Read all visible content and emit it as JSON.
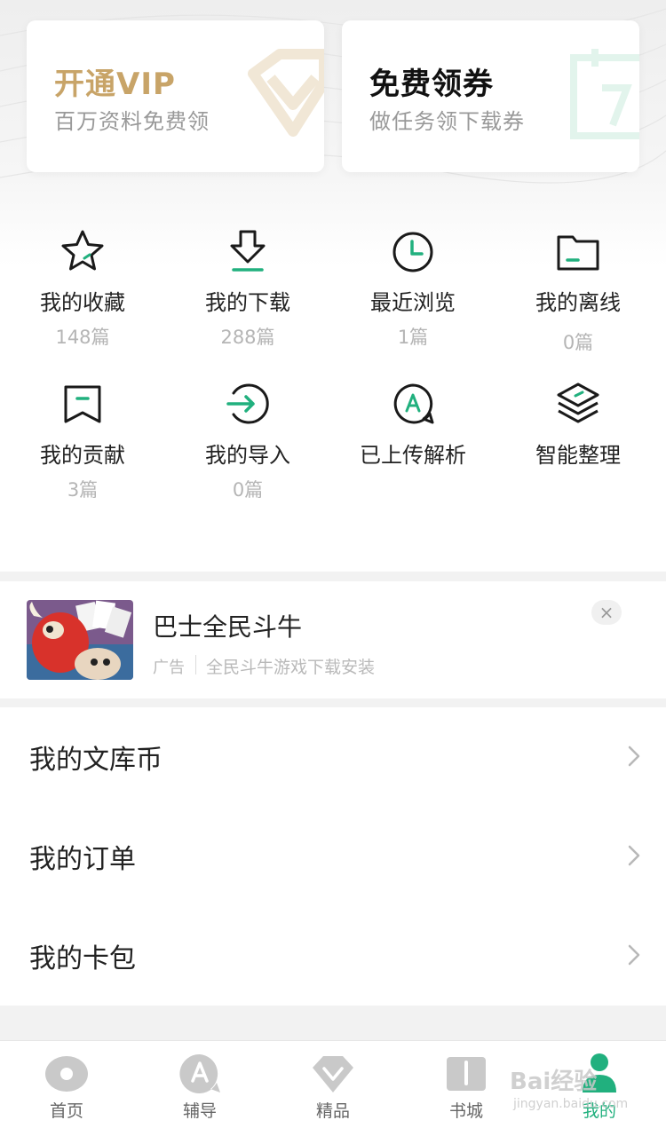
{
  "promos": {
    "vip": {
      "title": "开通VIP",
      "subtitle": "百万资料免费领",
      "icon": "diamond-icon"
    },
    "coupon": {
      "title": "免费领券",
      "subtitle": "做任务领下载券",
      "icon": "calendar-7-icon"
    }
  },
  "grid": [
    {
      "label": "我的收藏",
      "count": "148篇",
      "icon": "star-icon"
    },
    {
      "label": "我的下载",
      "count": "288篇",
      "icon": "download-icon"
    },
    {
      "label": "最近浏览",
      "count": "1篇",
      "icon": "clock-icon"
    },
    {
      "label": "我的离线",
      "count": "0篇",
      "icon": "folder-icon"
    },
    {
      "label": "我的贡献",
      "count": "3篇",
      "icon": "bookmark-icon"
    },
    {
      "label": "我的导入",
      "count": "0篇",
      "icon": "import-arrow-icon"
    },
    {
      "label": "已上传解析",
      "count": "",
      "icon": "chat-a-icon"
    },
    {
      "label": "智能整理",
      "count": "",
      "icon": "layers-icon"
    }
  ],
  "ad": {
    "title": "巴士全民斗牛",
    "tag": "广告",
    "description": "全民斗牛游戏下载安装",
    "close": "×"
  },
  "menu": [
    {
      "label": "我的文库币"
    },
    {
      "label": "我的订单"
    },
    {
      "label": "我的卡包"
    }
  ],
  "tabs": [
    {
      "label": "首页",
      "icon": "home-eye-icon",
      "active": false
    },
    {
      "label": "辅导",
      "icon": "tutor-a-icon",
      "active": false
    },
    {
      "label": "精品",
      "icon": "diamond-icon",
      "active": false
    },
    {
      "label": "书城",
      "icon": "book-icon",
      "active": false
    },
    {
      "label": "我的",
      "icon": "user-icon",
      "active": true
    }
  ],
  "watermark": {
    "main": "Bai经验",
    "sub": "jingyan.baidu.com"
  },
  "colors": {
    "accent": "#21b07e",
    "vip_gold": "#c8a468",
    "muted": "#b5b5b5",
    "band": "#f2f2f2"
  }
}
